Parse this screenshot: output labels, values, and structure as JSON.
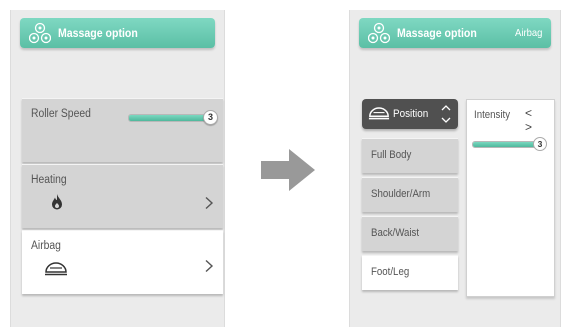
{
  "left_screen": {
    "header": {
      "title": "Massage option",
      "icon": "massage-rollers-icon"
    },
    "cards": [
      {
        "label": "Roller Speed",
        "value": "3",
        "level_fraction": 1.0
      },
      {
        "label": "Heating",
        "icon": "flame-icon"
      },
      {
        "label": "Airbag",
        "icon": "airbag-icon"
      }
    ]
  },
  "transition_arrow": "arrow-right-icon",
  "right_screen": {
    "header": {
      "title": "Massage option",
      "subtitle": "Airbag",
      "icon": "massage-rollers-icon"
    },
    "position_button": {
      "label": "Position",
      "icon": "airbag-icon"
    },
    "menu": [
      "Full Body",
      "Shoulder/Arm",
      "Back/Waist",
      "Foot/Leg"
    ],
    "selected_menu_item": "Foot/Leg",
    "intensity": {
      "label": "Intensity",
      "prev": "<",
      "next": ">",
      "value": "3",
      "level_fraction": 1.0
    }
  },
  "colors": {
    "accent": "#5bbfa5",
    "panel_bg": "#ebebeb",
    "card_bg": "#d4d4d4",
    "position_button_bg": "#505050"
  }
}
